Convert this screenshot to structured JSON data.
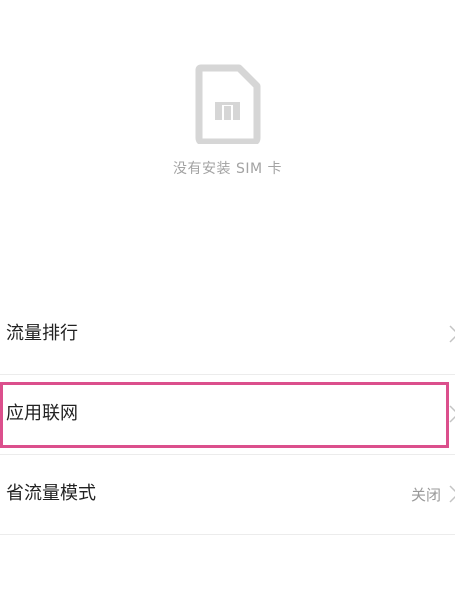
{
  "empty_state": {
    "icon": "sim-card-icon",
    "message": "没有安装 SIM 卡"
  },
  "menu": {
    "items": [
      {
        "label": "流量排行",
        "value": "",
        "icon": "chevron-right-icon"
      },
      {
        "label": "应用联网",
        "value": "",
        "icon": "chevron-right-icon"
      },
      {
        "label": "省流量模式",
        "value": "关闭",
        "icon": "chevron-right-icon"
      }
    ]
  },
  "colors": {
    "highlight": "#db4f8c",
    "icon_gray": "#d6d6d6",
    "secondary_text": "#a3a3a3"
  }
}
